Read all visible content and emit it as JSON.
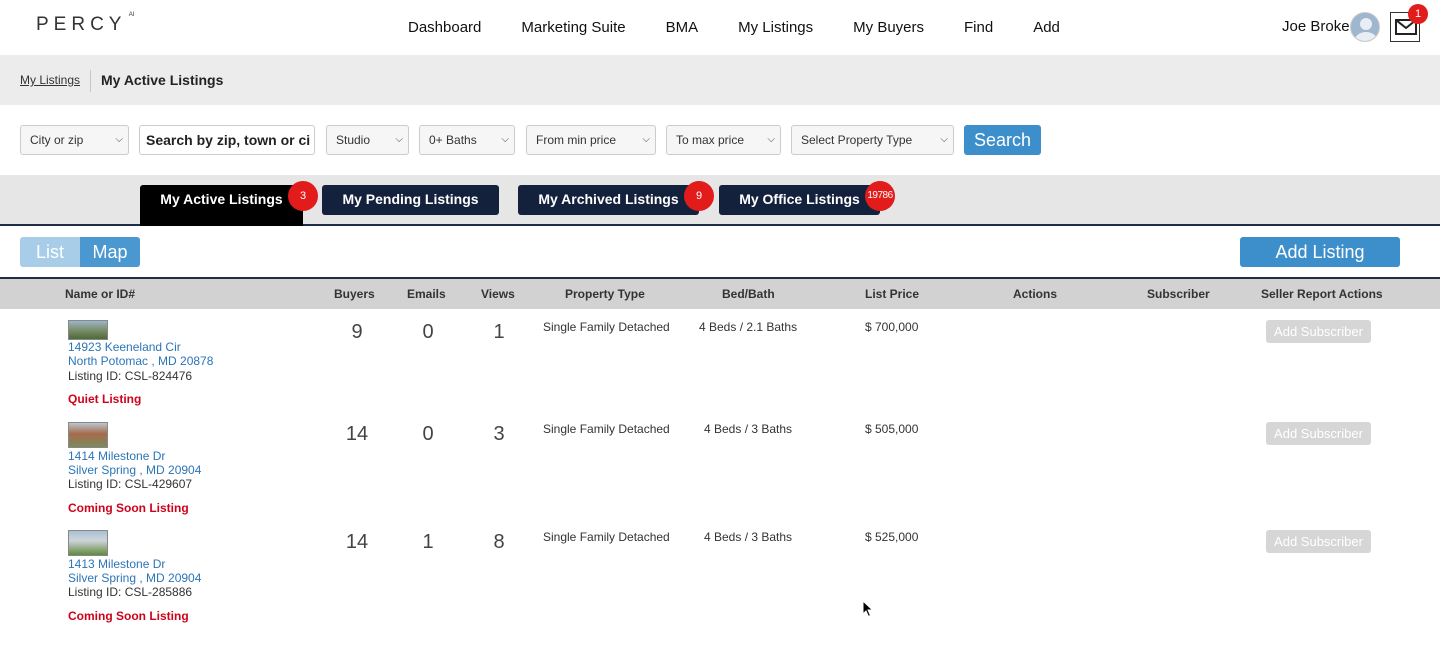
{
  "app": {
    "logo": "PERCY",
    "logo_sup": "AI",
    "nav": [
      "Dashboard",
      "Marketing Suite",
      "BMA",
      "My Listings",
      "My Buyers",
      "Find",
      "Add"
    ],
    "user_name": "Joe Broker",
    "mail_count": "1"
  },
  "breadcrumb": {
    "parent": "My Listings",
    "current": "My Active Listings"
  },
  "filters": {
    "location": "City or zip",
    "search_placeholder": "Search by zip, town or ci",
    "beds": "Studio",
    "baths": "0+ Baths",
    "min_price": "From min price",
    "max_price": "To max price",
    "property_type": "Select Property Type",
    "search_label": "Search"
  },
  "tabs": [
    {
      "label": "My Active Listings",
      "badge": "3"
    },
    {
      "label": "My Pending Listings",
      "badge": ""
    },
    {
      "label": "My Archived Listings",
      "badge": "9"
    },
    {
      "label": "My Office Listings",
      "badge": "19786"
    }
  ],
  "view_toggle": {
    "list": "List",
    "map": "Map"
  },
  "add_listing_label": "Add Listing",
  "table": {
    "headers": [
      "Name or ID#",
      "Buyers",
      "Emails",
      "Views",
      "Property Type",
      "Bed/Bath",
      "List Price",
      "Actions",
      "Subscriber",
      "Seller Report Actions"
    ],
    "rows": [
      {
        "street": "14923 Keeneland Cir",
        "city": "North Potomac , MD 20878",
        "listing_id": "Listing ID: CSL-824476",
        "status": "Quiet Listing",
        "buyers": "9",
        "emails": "0",
        "views": "1",
        "type": "Single Family Detached",
        "bedbath": "4 Beds / 2.1 Baths",
        "price": "$ 700,000",
        "action": "Add Subscriber"
      },
      {
        "street": "1414 Milestone Dr",
        "city": "Silver Spring , MD 20904",
        "listing_id": "Listing ID: CSL-429607",
        "status": "Coming Soon Listing",
        "buyers": "14",
        "emails": "0",
        "views": "3",
        "type": "Single Family Detached",
        "bedbath": "4 Beds / 3 Baths",
        "price": "$ 505,000",
        "action": "Add Subscriber"
      },
      {
        "street": "1413 Milestone Dr",
        "city": "Silver Spring , MD 20904",
        "listing_id": "Listing ID: CSL-285886",
        "status": "Coming Soon Listing",
        "buyers": "14",
        "emails": "1",
        "views": "8",
        "type": "Single Family Detached",
        "bedbath": "4 Beds / 3 Baths",
        "price": "$ 525,000",
        "action": "Add Subscriber"
      }
    ]
  }
}
